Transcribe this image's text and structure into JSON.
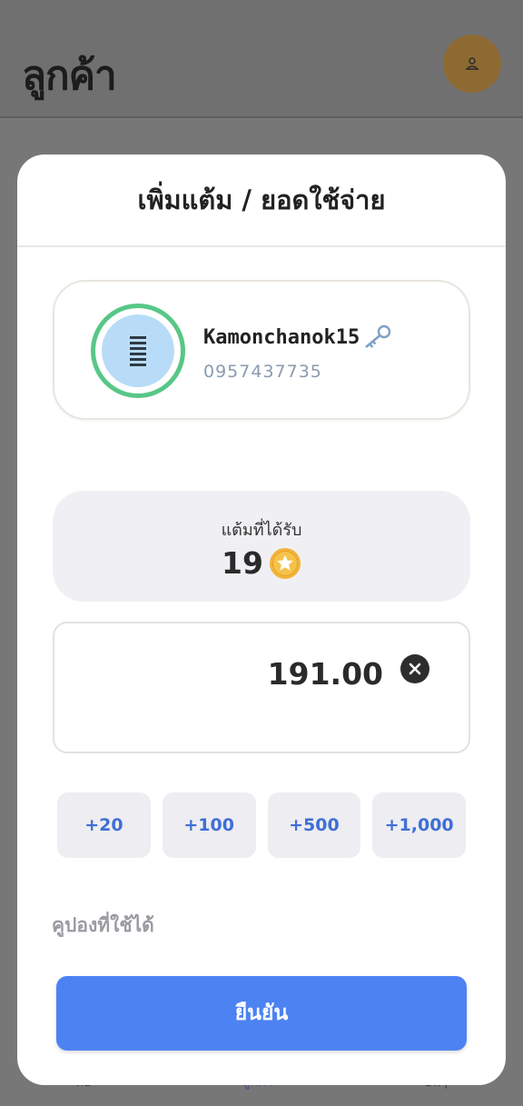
{
  "app": {
    "page_title": "ลูกค้า",
    "tabs": [
      {
        "label": "ต่อ"
      },
      {
        "label": "ลูกค้า"
      },
      {
        "label": "อื่นๆ"
      }
    ]
  },
  "modal": {
    "title": "เพิ่มแต้ม / ยอดใช้จ่าย",
    "customer": {
      "name": "Kamonchanok15",
      "phone": "0957437735",
      "avatar_icon": "striped-avatar-icon",
      "badge_icon": "key-icon"
    },
    "points": {
      "label": "แต้มที่ได้รับ",
      "value": "19",
      "icon": "star-coin-icon"
    },
    "amount": {
      "value": "191.00",
      "clear_icon": "close-circle-icon"
    },
    "quick_add": [
      {
        "label": "+20"
      },
      {
        "label": "+100"
      },
      {
        "label": "+500"
      },
      {
        "label": "+1,000"
      }
    ],
    "coupons_label": "คูปองที่ใช้ได้",
    "confirm_label": "ยืนยัน"
  },
  "colors": {
    "accent": "#4d82f3",
    "quick_text": "#3f6fd6",
    "avatar_ring": "#57c786",
    "star": "#f2b43a"
  }
}
